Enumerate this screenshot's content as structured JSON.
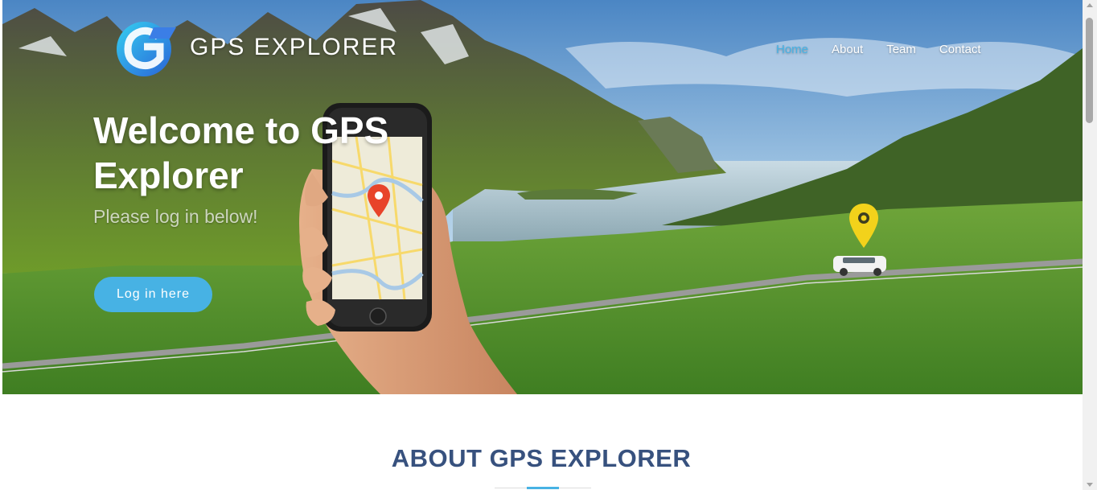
{
  "header": {
    "brand": "GPS EXPLORER",
    "nav": [
      {
        "label": "Home",
        "active": true
      },
      {
        "label": "About",
        "active": false
      },
      {
        "label": "Team",
        "active": false
      },
      {
        "label": "Contact",
        "active": false
      }
    ]
  },
  "hero": {
    "headline": "Welcome to GPS Explorer",
    "subtitle": "Please log in below!",
    "cta_label": "Log in here",
    "pin_color": "#f2d21b",
    "map_pin_color": "#e8442a"
  },
  "about": {
    "title": "ABOUT GPS EXPLORER"
  },
  "colors": {
    "accent": "#47b2e4",
    "heading": "#37517e"
  }
}
